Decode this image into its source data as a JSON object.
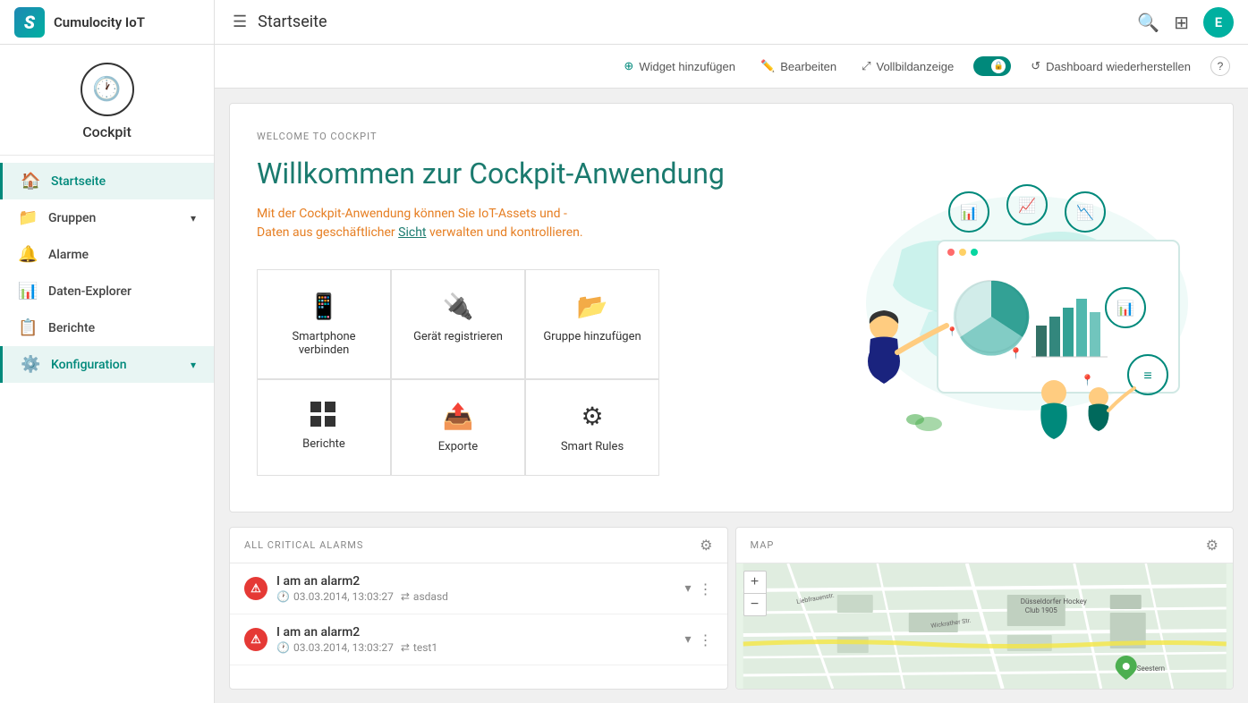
{
  "topbar": {
    "brand": "S",
    "app_name": "Cumulocity IoT",
    "page_title": "Startseite",
    "avatar_letter": "E"
  },
  "sidebar": {
    "logo_label": "Cockpit",
    "nav_items": [
      {
        "id": "startseite",
        "label": "Startseite",
        "icon": "🏠",
        "active": true
      },
      {
        "id": "gruppen",
        "label": "Gruppen",
        "icon": "📁",
        "has_chevron": true
      },
      {
        "id": "alarme",
        "label": "Alarme",
        "icon": "🔔"
      },
      {
        "id": "daten-explorer",
        "label": "Daten-Explorer",
        "icon": "📊"
      },
      {
        "id": "berichte",
        "label": "Berichte",
        "icon": "📋"
      },
      {
        "id": "konfiguration",
        "label": "Konfiguration",
        "icon": "⚙️",
        "has_chevron": true,
        "active_config": true
      }
    ]
  },
  "toolbar": {
    "widget_btn": "Widget hinzufügen",
    "edit_btn": "Bearbeiten",
    "fullscreen_btn": "Vollbildanzeige",
    "restore_btn": "Dashboard wiederherstellen",
    "help_icon": "?"
  },
  "welcome": {
    "label": "WELCOME TO COCKPIT",
    "title": "Willkommen zur Cockpit-Anwendung",
    "description": "Mit der Cockpit-Anwendung können Sie IoT-Assets und -Daten aus geschäftlicher Sicht verwalten und kontrollieren.",
    "highlight_word": "Sicht"
  },
  "action_cards": [
    {
      "id": "smartphone",
      "icon": "📱",
      "label": "Smartphone\nverbinden"
    },
    {
      "id": "register",
      "icon": "🔌",
      "label": "Gerät registrieren"
    },
    {
      "id": "group",
      "icon": "📂",
      "label": "Gruppe hinzufügen"
    },
    {
      "id": "berichte",
      "icon": "⊞",
      "label": "Berichte"
    },
    {
      "id": "exporte",
      "icon": "📤",
      "label": "Exporte"
    },
    {
      "id": "smartrules",
      "icon": "⚙",
      "label": "Smart Rules"
    }
  ],
  "alarms": {
    "panel_title": "ALL CRITICAL ALARMS",
    "items": [
      {
        "name": "I am an alarm2",
        "time": "03.03.2014, 13:03:27",
        "device": "asdasd"
      },
      {
        "name": "I am an alarm2",
        "time": "03.03.2014, 13:03:27",
        "device": "test1"
      }
    ]
  },
  "map": {
    "panel_title": "MAP"
  },
  "colors": {
    "brand_teal": "#00897b",
    "brand_blue": "#1e88b4",
    "alarm_red": "#e53935",
    "orange_text": "#e67e22",
    "title_green": "#1a7a6e"
  }
}
